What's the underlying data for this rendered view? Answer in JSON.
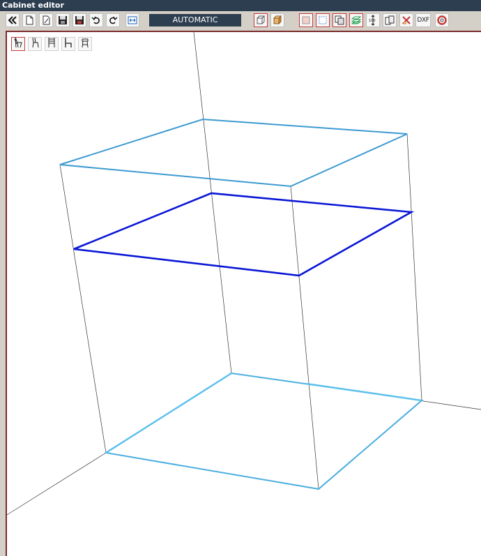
{
  "window": {
    "title": "Cabinet editor"
  },
  "toolbar": {
    "mode_value": "AUTOMATIC",
    "dxf_label": "DXF",
    "counter_label": "100",
    "buttons": [
      {
        "name": "collapse-button",
        "icon": "double-chevron-left-icon"
      },
      {
        "name": "new-button",
        "icon": "new-document-icon"
      },
      {
        "name": "open-button",
        "icon": "open-document-icon"
      },
      {
        "name": "save-button",
        "icon": "floppy-disk-icon"
      },
      {
        "name": "save-as-button",
        "icon": "floppy-disk-red-icon"
      },
      {
        "name": "undo-button",
        "icon": "undo-icon"
      },
      {
        "name": "redo-button",
        "icon": "redo-icon"
      },
      {
        "name": "fit-view-button",
        "icon": "fit-width-icon"
      },
      {
        "name": "wireframe-view-button",
        "icon": "wireframe-box-icon"
      },
      {
        "name": "solid-view-button",
        "icon": "solid-box-icon"
      },
      {
        "name": "panel-button",
        "icon": "panel-icon"
      },
      {
        "name": "dotted-panel-button",
        "icon": "dotted-panel-icon"
      },
      {
        "name": "copy-panel-button",
        "icon": "copy-panel-icon"
      },
      {
        "name": "layers-button",
        "icon": "layers-icon"
      },
      {
        "name": "dimension-button",
        "icon": "vertical-dimension-icon"
      },
      {
        "name": "duplicate-button",
        "icon": "duplicate-icon"
      },
      {
        "name": "delete-tool-button",
        "icon": "delete-tool-icon"
      },
      {
        "name": "dxf-export-button",
        "icon": "dxf-icon"
      },
      {
        "name": "help-button",
        "icon": "lifebuoy-icon"
      }
    ]
  },
  "view_presets": [
    {
      "name": "view-preset-1",
      "icon": "chair-perspective-icon",
      "active": true
    },
    {
      "name": "view-preset-2",
      "icon": "chair-side-icon",
      "active": false
    },
    {
      "name": "view-preset-3",
      "icon": "chair-front-icon",
      "active": false
    },
    {
      "name": "view-preset-4",
      "icon": "chair-profile-icon",
      "active": false
    },
    {
      "name": "view-preset-5",
      "icon": "stool-icon",
      "active": false
    }
  ],
  "colors": {
    "titlebar": "#2d3e50",
    "accent_red": "#c23a3a",
    "cabinet_edge": "#3d9ad1",
    "cabinet_bottom_edge": "#5bc0ee",
    "selected_shelf": "#0a16d6",
    "axis_line": "#333333"
  }
}
